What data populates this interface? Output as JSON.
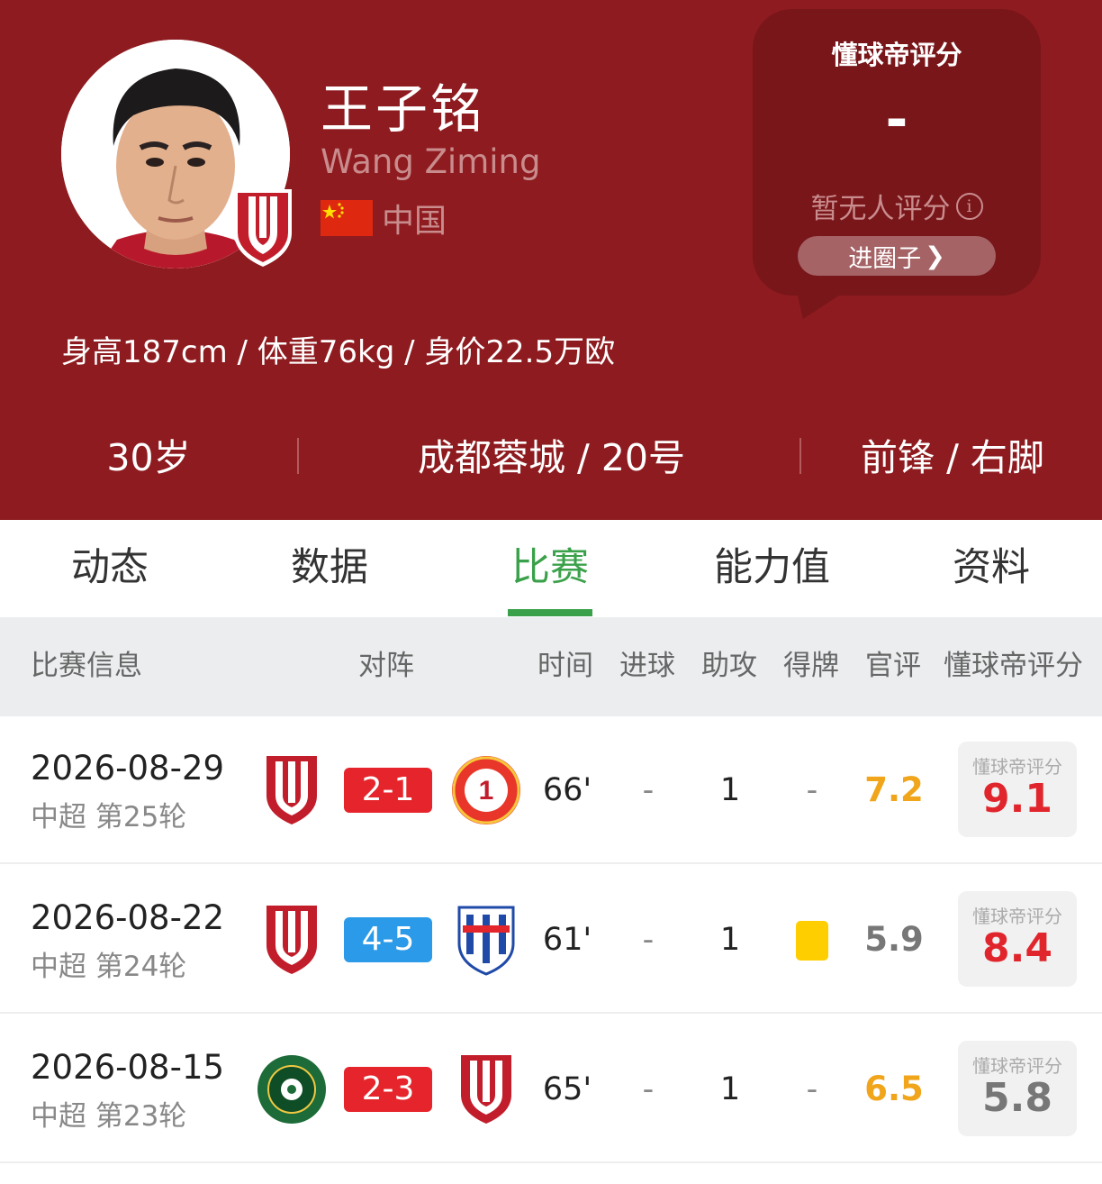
{
  "player": {
    "name_cn": "王子铭",
    "name_en": "Wang Ziming",
    "nationality": "中国",
    "stats_line": "身高187cm / 体重76kg / 身价22.5万欧",
    "age": "30岁",
    "club_number": "成都蓉城 / 20号",
    "position_foot": "前锋 / 右脚"
  },
  "rating": {
    "title": "懂球帝评分",
    "value": "-",
    "empty_text": "暂无人评分",
    "info_icon": "info-icon",
    "button_label": "进圈子",
    "button_icon": "chevron-right-icon"
  },
  "tabs": [
    {
      "label": "动态"
    },
    {
      "label": "数据"
    },
    {
      "label": "比赛",
      "active": true
    },
    {
      "label": "能力值"
    },
    {
      "label": "资料"
    }
  ],
  "table": {
    "headers": [
      "比赛信息",
      "对阵",
      "时间",
      "进球",
      "助攻",
      "得牌",
      "官评",
      "懂球帝评分"
    ],
    "fan_rating_label": "懂球帝评分",
    "rows": [
      {
        "date": "2026-08-29",
        "round": "中超 第25轮",
        "home": "成都蓉城",
        "away": "辽宁铁人",
        "score": "2-1",
        "result": "win",
        "minutes": "66'",
        "goals": "-",
        "assists": "1",
        "cards": "-",
        "official": "7.2",
        "official_color": "#f0a51b",
        "fan": "9.1",
        "fan_color": "#e0262c"
      },
      {
        "date": "2026-08-22",
        "round": "中超 第24轮",
        "home": "成都蓉城",
        "away": "上海申花",
        "score": "4-5",
        "result": "lose",
        "minutes": "61'",
        "goals": "-",
        "assists": "1",
        "cards": "yellow-card",
        "official": "5.9",
        "official_color": "#777777",
        "fan": "8.4",
        "fan_color": "#e0262c"
      },
      {
        "date": "2026-08-15",
        "round": "中超 第23轮",
        "home": "浙江",
        "away": "成都蓉城",
        "score": "2-3",
        "result": "win",
        "minutes": "65'",
        "goals": "-",
        "assists": "1",
        "cards": "-",
        "official": "6.5",
        "official_color": "#f0a51b",
        "fan": "5.8",
        "fan_color": "#777777"
      }
    ]
  },
  "colors": {
    "header_bg": "#8e1b1f",
    "accent_green": "#3aa14a",
    "win_red": "#e5252b",
    "lose_blue": "#2b9ae8"
  }
}
